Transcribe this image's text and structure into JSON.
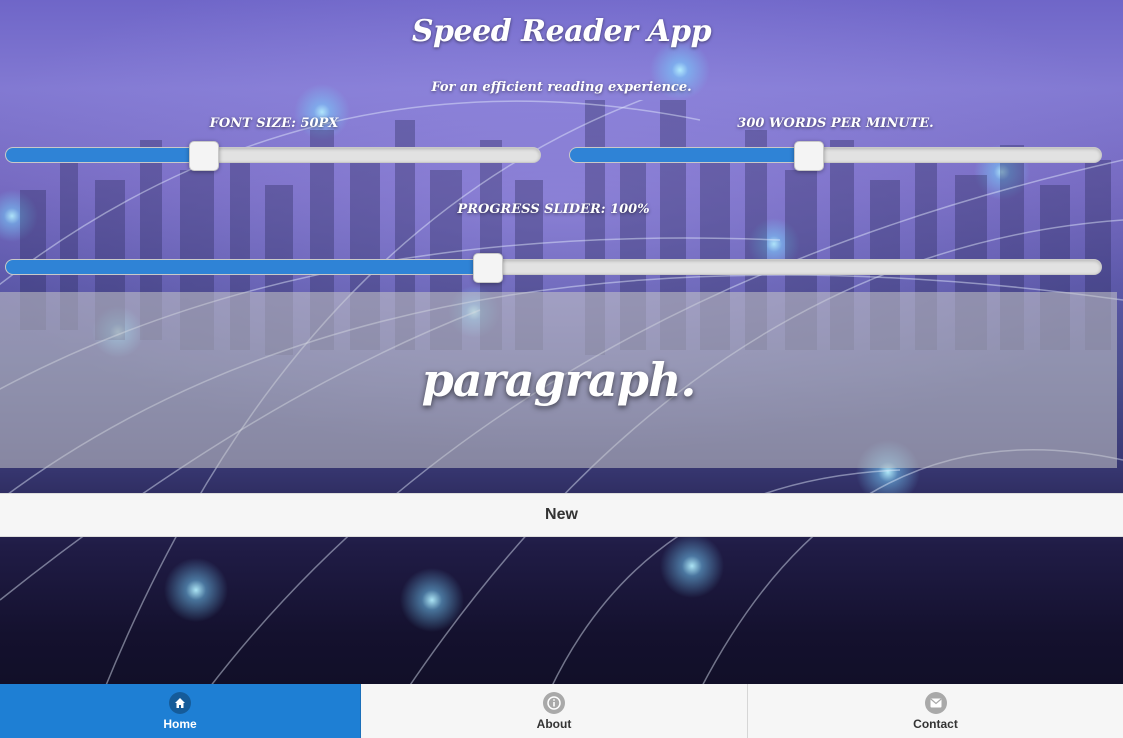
{
  "header": {
    "title": "Speed Reader App",
    "subtitle": "For an efficient reading experience."
  },
  "controls": {
    "font_size": {
      "label": "FONT SIZE: 50PX",
      "value": 0.37
    },
    "wpm": {
      "label": "300 WORDS PER MINUTE.",
      "value": 0.45
    },
    "progress": {
      "label": "PROGRESS SLIDER: 100%",
      "value": 0.44
    }
  },
  "reader": {
    "current_word": "paragraph."
  },
  "actions": {
    "new_label": "New"
  },
  "nav": {
    "items": [
      {
        "label": "Home",
        "icon": "home-icon",
        "active": true
      },
      {
        "label": "About",
        "icon": "info-icon",
        "active": false
      },
      {
        "label": "Contact",
        "icon": "mail-icon",
        "active": false
      }
    ]
  },
  "colors": {
    "accent": "#1e7fd4",
    "slider_fill": "#2f83d6",
    "panel": "#c8c8c8"
  }
}
